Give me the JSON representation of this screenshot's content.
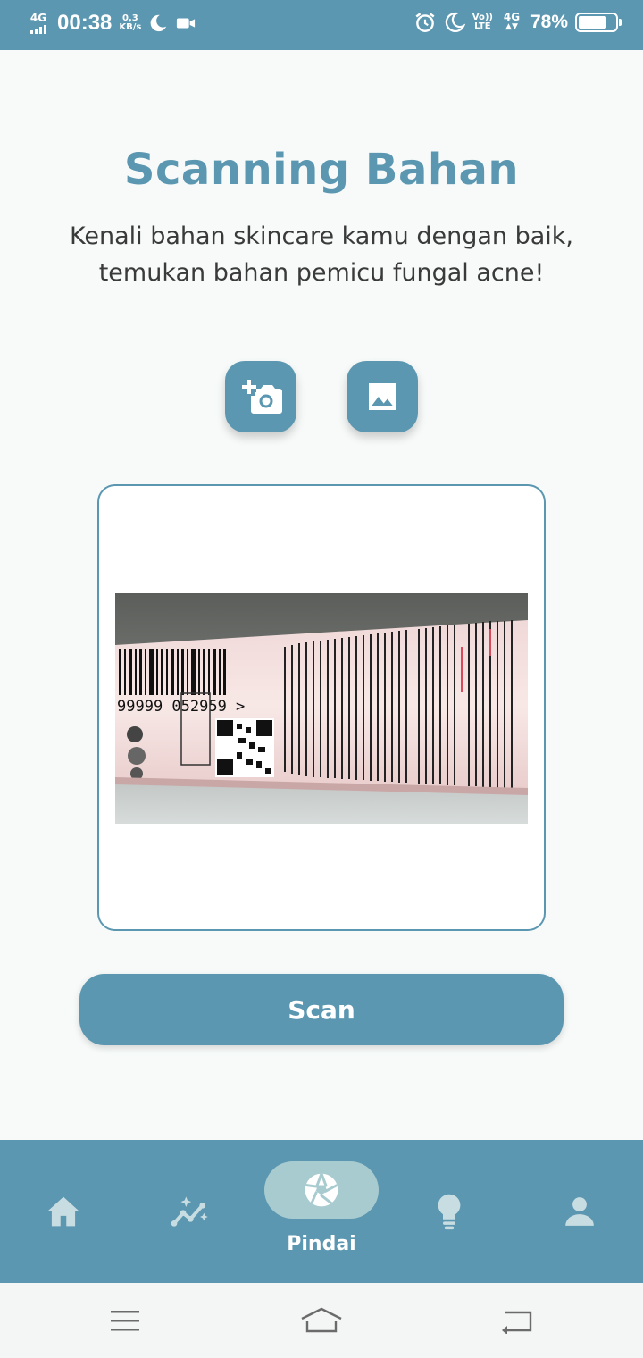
{
  "status_bar": {
    "network": "4G",
    "time": "00:38",
    "speed_value": "0,3",
    "speed_unit": "KB/s",
    "volte_top": "Vo))",
    "volte_bottom": "LTE",
    "network_right": "4G",
    "battery_percent": "78%",
    "battery_level": 0.78,
    "icons": [
      "signal-icon",
      "moon-icon",
      "video-camera-icon",
      "alarm-icon",
      "moon-icon",
      "battery-icon"
    ]
  },
  "main": {
    "title": "Scanning Bahan",
    "subtitle": "Kenali bahan skincare kamu dengan baik, temukan bahan pemicu fungal acne!",
    "camera_button_icon": "add-a-photo-icon",
    "gallery_button_icon": "image-icon",
    "scan_label": "Scan"
  },
  "bottom_nav": {
    "items": [
      {
        "icon": "home-icon",
        "label": ""
      },
      {
        "icon": "stats-sparkle-icon",
        "label": ""
      },
      {
        "icon": "shutter-icon",
        "label": "Pindai",
        "active": true
      },
      {
        "icon": "lightbulb-icon",
        "label": ""
      },
      {
        "icon": "person-icon",
        "label": ""
      }
    ]
  },
  "colors": {
    "primary": "#5b97b1",
    "active_pill": "#a8cbd0",
    "background": "#f7faf9"
  }
}
